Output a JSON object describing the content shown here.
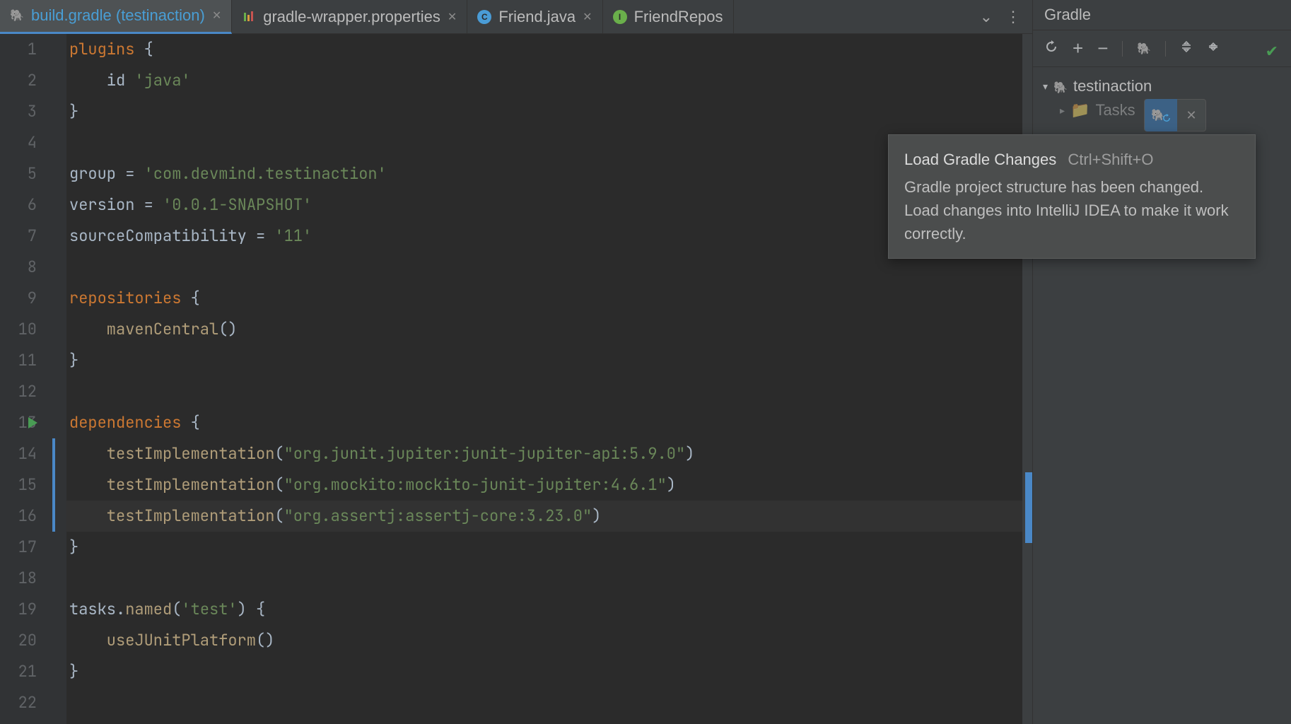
{
  "tabs": [
    {
      "label": "build.gradle (testinaction)",
      "icon": "gradle",
      "active": true
    },
    {
      "label": "gradle-wrapper.properties",
      "icon": "prop",
      "active": false
    },
    {
      "label": "Friend.java",
      "icon": "java-c",
      "active": false
    },
    {
      "label": "FriendRepos",
      "icon": "java-i",
      "active": false
    }
  ],
  "code": {
    "lines": [
      {
        "n": 1,
        "segs": [
          [
            "kw",
            "plugins"
          ],
          [
            "punc",
            " {"
          ]
        ]
      },
      {
        "n": 2,
        "segs": [
          [
            "id",
            "    id "
          ],
          [
            "str",
            "'java'"
          ]
        ]
      },
      {
        "n": 3,
        "segs": [
          [
            "punc",
            "}"
          ]
        ]
      },
      {
        "n": 4,
        "segs": [
          [
            "",
            ""
          ]
        ]
      },
      {
        "n": 5,
        "segs": [
          [
            "id",
            "group = "
          ],
          [
            "str",
            "'com.devmind.testinaction'"
          ]
        ]
      },
      {
        "n": 6,
        "segs": [
          [
            "id",
            "version = "
          ],
          [
            "str",
            "'0.0.1-SNAPSHOT'"
          ]
        ]
      },
      {
        "n": 7,
        "segs": [
          [
            "id",
            "sourceCompatibility = "
          ],
          [
            "str",
            "'11'"
          ]
        ]
      },
      {
        "n": 8,
        "segs": [
          [
            "",
            ""
          ]
        ]
      },
      {
        "n": 9,
        "segs": [
          [
            "kw",
            "repositories"
          ],
          [
            "punc",
            " {"
          ]
        ]
      },
      {
        "n": 10,
        "segs": [
          [
            "fn",
            "    mavenCentral"
          ],
          [
            "punc",
            "()"
          ]
        ]
      },
      {
        "n": 11,
        "segs": [
          [
            "punc",
            "}"
          ]
        ]
      },
      {
        "n": 12,
        "segs": [
          [
            "",
            ""
          ]
        ]
      },
      {
        "n": 13,
        "segs": [
          [
            "kw",
            "dependencies"
          ],
          [
            "punc",
            " {"
          ]
        ],
        "run": true
      },
      {
        "n": 14,
        "segs": [
          [
            "fn",
            "    testImplementation"
          ],
          [
            "punc",
            "("
          ],
          [
            "str",
            "\"org.junit.jupiter:junit-jupiter-api:5.9.0\""
          ],
          [
            "punc",
            ")"
          ]
        ],
        "changed": true
      },
      {
        "n": 15,
        "segs": [
          [
            "fn",
            "    testImplementation"
          ],
          [
            "punc",
            "("
          ],
          [
            "str",
            "\"org.mockito:mockito-junit-jupiter:4.6.1\""
          ],
          [
            "punc",
            ")"
          ]
        ],
        "changed": true
      },
      {
        "n": 16,
        "segs": [
          [
            "fn",
            "    testImplementation"
          ],
          [
            "punc",
            "("
          ],
          [
            "str",
            "\"org.assertj:assertj-core:3.23.0\""
          ],
          [
            "punc",
            ")"
          ]
        ],
        "changed": true,
        "caret": true
      },
      {
        "n": 17,
        "segs": [
          [
            "punc",
            "}"
          ]
        ]
      },
      {
        "n": 18,
        "segs": [
          [
            "",
            ""
          ]
        ]
      },
      {
        "n": 19,
        "segs": [
          [
            "id",
            "tasks."
          ],
          [
            "fn",
            "named"
          ],
          [
            "punc",
            "("
          ],
          [
            "str",
            "'test'"
          ],
          [
            "punc",
            ") {"
          ]
        ]
      },
      {
        "n": 20,
        "segs": [
          [
            "fn",
            "    useJUnitPlatform"
          ],
          [
            "punc",
            "()"
          ]
        ]
      },
      {
        "n": 21,
        "segs": [
          [
            "punc",
            "}"
          ]
        ]
      },
      {
        "n": 22,
        "segs": [
          [
            "",
            ""
          ]
        ]
      }
    ]
  },
  "gradle": {
    "title": "Gradle",
    "tree_root": "testinaction",
    "tree_child": "Tasks"
  },
  "tooltip": {
    "title": "Load Gradle Changes",
    "shortcut": "Ctrl+Shift+O",
    "body": "Gradle project structure has been changed. Load changes into IntelliJ IDEA to make it work correctly."
  }
}
